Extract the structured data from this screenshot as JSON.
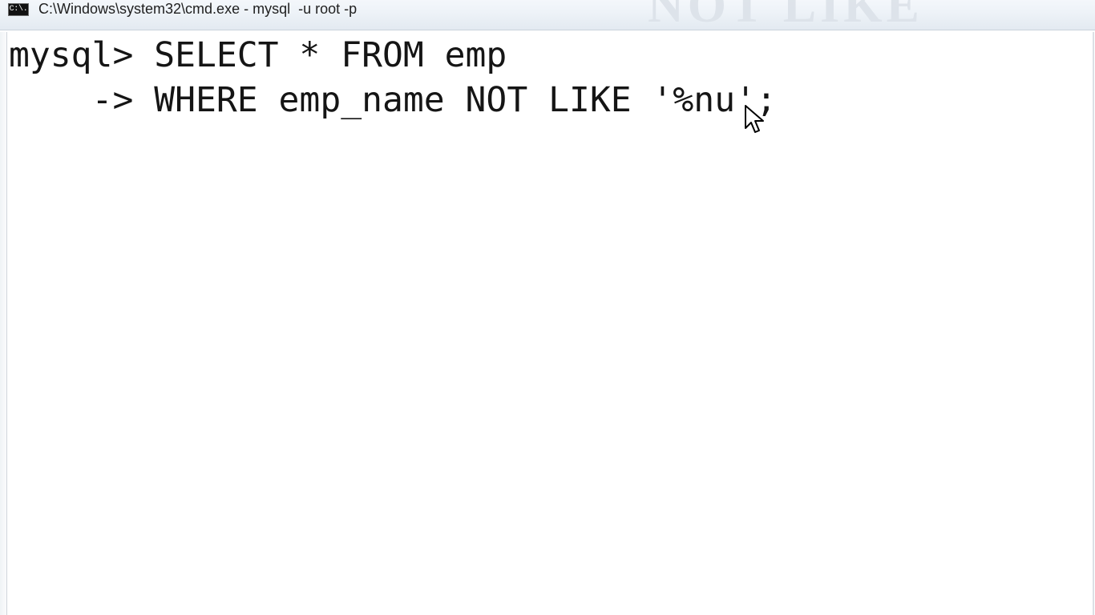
{
  "window": {
    "title": "C:\\Windows\\system32\\cmd.exe - mysql  -u root -p",
    "icon": "cmd-icon",
    "icon_label": "C:\\."
  },
  "background": {
    "banner_text": "NOT LIKE"
  },
  "terminal": {
    "lines": [
      "mysql> SELECT * FROM emp",
      "    -> WHERE emp_name NOT LIKE '%nu';"
    ]
  },
  "pointer": {
    "icon": "mouse-pointer-icon"
  }
}
